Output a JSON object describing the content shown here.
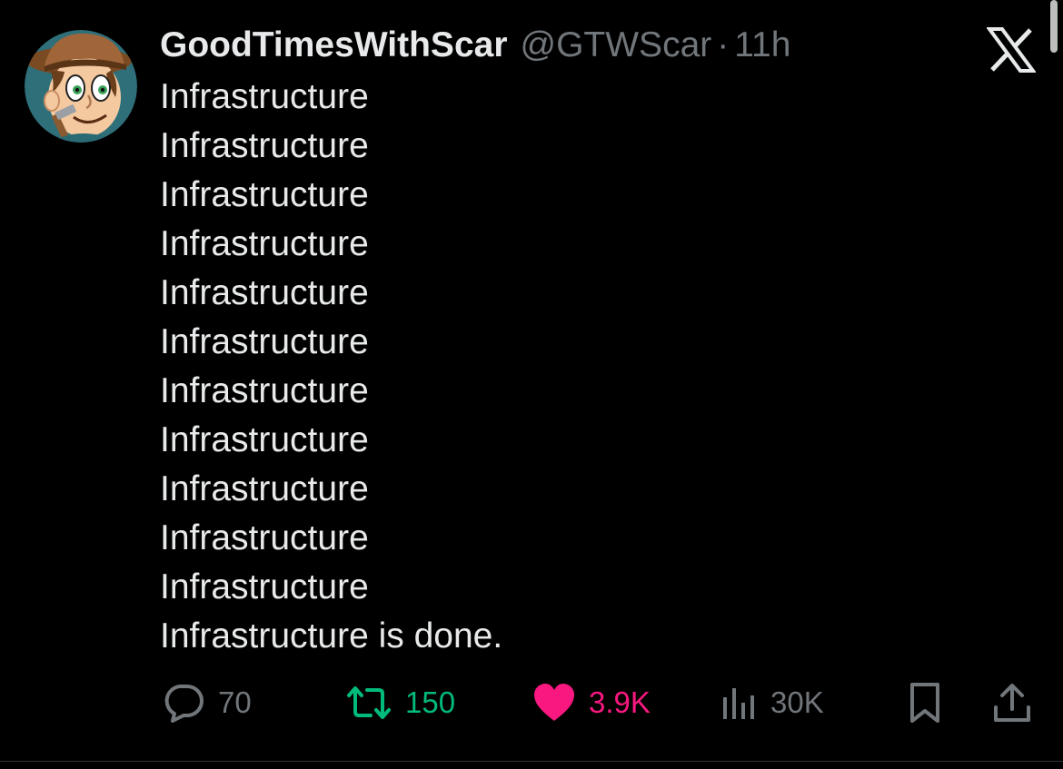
{
  "tweet": {
    "author": {
      "display_name": "GoodTimesWithScar",
      "handle": "@GTWScar",
      "avatar_icon": "cartoon-avatar-icon"
    },
    "separator": "·",
    "time_ago": "11h",
    "lines": [
      "Infrastructure",
      "Infrastructure",
      "Infrastructure",
      "Infrastructure",
      "Infrastructure",
      "Infrastructure",
      "Infrastructure",
      "Infrastructure",
      "Infrastructure",
      "Infrastructure",
      "Infrastructure",
      "Infrastructure is done."
    ],
    "actions": {
      "reply": {
        "count": "70",
        "icon": "reply-icon",
        "color": "#71767b"
      },
      "retweet": {
        "count": "150",
        "icon": "retweet-icon",
        "color": "#00ba7c"
      },
      "like": {
        "count": "3.9K",
        "icon": "heart-icon",
        "color": "#f91880"
      },
      "views": {
        "count": "30K",
        "icon": "views-icon",
        "color": "#71767b"
      },
      "bookmark": {
        "icon": "bookmark-icon",
        "color": "#71767b"
      },
      "share": {
        "icon": "share-icon",
        "color": "#71767b"
      }
    }
  },
  "brand": {
    "logo_icon": "x-logo-icon",
    "background": "#000000",
    "text_color": "#e7e9ea",
    "muted_color": "#71767b"
  }
}
